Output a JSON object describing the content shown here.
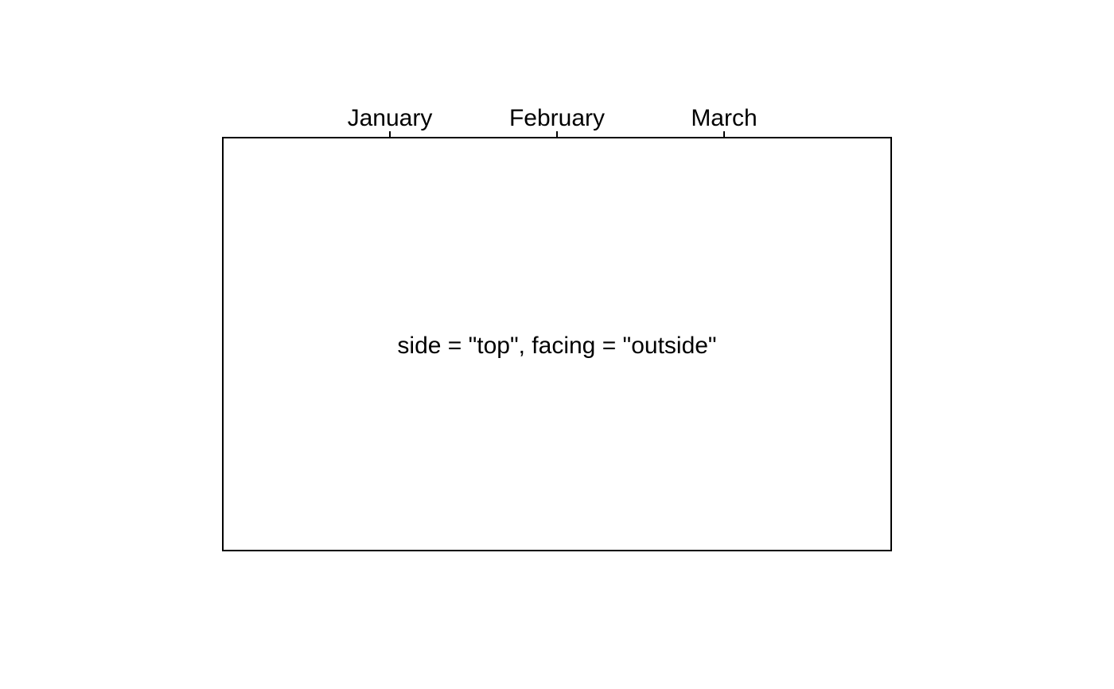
{
  "chart_data": {
    "type": "scatter",
    "title": "",
    "xlabel": "",
    "ylabel": "",
    "axis": {
      "side": "top",
      "tick_direction": "outside",
      "categories": [
        "January",
        "February",
        "March"
      ],
      "xlim": [
        0,
        4
      ]
    },
    "annotation": "side = \"top\", facing = \"outside\"",
    "series": [],
    "grid": false,
    "frame": true
  },
  "colors": {
    "background": "#ffffff",
    "ink": "#000000"
  }
}
